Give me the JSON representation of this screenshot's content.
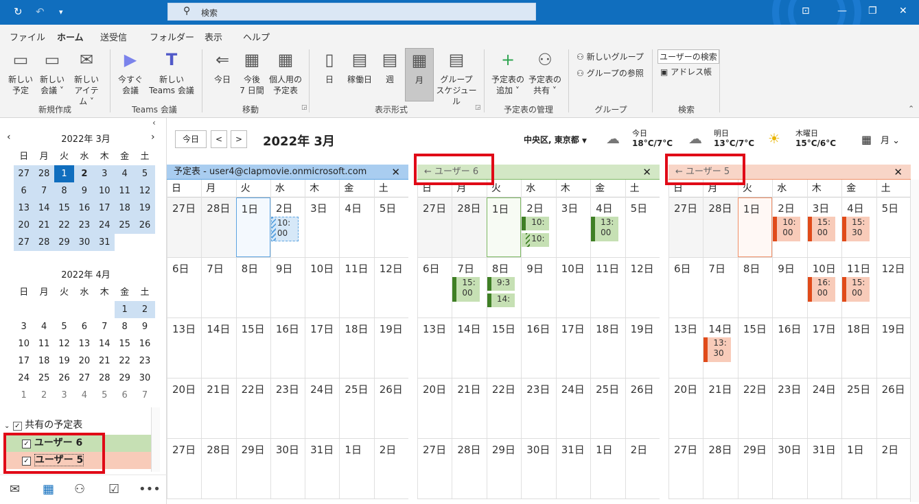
{
  "app": {
    "search_placeholder": "検索",
    "colors": {
      "accent": "#106ebe",
      "user6": "#c6e0b4",
      "user6_bar": "#3f7f25",
      "user5": "#f8cbb9",
      "user5_bar": "#e04b1a",
      "default": "#a9cdf0"
    }
  },
  "quick_access": {
    "sync_icon": "↻",
    "undo_icon": "↶",
    "custom_icon": "▾"
  },
  "menu": {
    "tabs": [
      "ファイル",
      "ホーム",
      "送受信",
      "フォルダー",
      "表示",
      "ヘルプ"
    ]
  },
  "ribbon": {
    "buttons": [
      {
        "label": "新しい\n予定",
        "icon": "calendar-new-icon",
        "g": "▭"
      },
      {
        "label": "新しい\n会議 ˅",
        "icon": "meeting-icon",
        "g": "▭"
      },
      {
        "label": "新しい\nアイテム ˅",
        "icon": "new-item-icon",
        "g": "✉"
      },
      {
        "label": "今すぐ\n会議",
        "icon": "video-icon",
        "g": "▶"
      },
      {
        "label": "新しい\nTeams 会議",
        "icon": "teams-icon",
        "g": "T"
      },
      {
        "label": "今日",
        "icon": "today-icon",
        "g": "⇐"
      },
      {
        "label": "今後\n7 日間",
        "icon": "next7-icon",
        "g": "▦"
      },
      {
        "label": "個人用の\n予定表",
        "icon": "personal-cal-icon",
        "g": "▦"
      },
      {
        "label": "日",
        "icon": "day-view-icon",
        "g": "▯"
      },
      {
        "label": "稼働日",
        "icon": "workweek-icon",
        "g": "▤"
      },
      {
        "label": "週",
        "icon": "week-view-icon",
        "g": "▤"
      },
      {
        "label": "月",
        "icon": "month-view-icon",
        "g": "▦"
      },
      {
        "label": "グループ\nスケジュール",
        "icon": "group-schedule-icon",
        "g": "▤"
      },
      {
        "label": "予定表の\n追加 ˅",
        "icon": "add-calendar-icon",
        "g": "+"
      },
      {
        "label": "予定表の\n共有 ˅",
        "icon": "share-calendar-icon",
        "g": "⚇"
      }
    ],
    "groups": [
      "新規作成",
      "Teams 会議",
      "移動",
      "表示形式",
      "予定表の管理",
      "グループ",
      "検索"
    ],
    "small": {
      "new_group": "新しいグループ",
      "browse_group": "グループの参照",
      "user_search": "ユーザーの検索",
      "address_book": "アドレス帳"
    }
  },
  "minical": [
    {
      "title": "2022年 3月",
      "days": [
        "日",
        "月",
        "火",
        "水",
        "木",
        "金",
        "土"
      ],
      "cells": [
        "27",
        "28",
        "1",
        "2",
        "3",
        "4",
        "5",
        "6",
        "7",
        "8",
        "9",
        "10",
        "11",
        "12",
        "13",
        "14",
        "15",
        "16",
        "17",
        "18",
        "19",
        "20",
        "21",
        "22",
        "23",
        "24",
        "25",
        "26",
        "27",
        "28",
        "29",
        "30",
        "31"
      ]
    },
    {
      "title": "2022年 4月",
      "days": [
        "日",
        "月",
        "火",
        "水",
        "木",
        "金",
        "土"
      ],
      "cells": [
        "",
        "",
        "",
        "",
        "",
        "1",
        "2",
        "3",
        "4",
        "5",
        "6",
        "7",
        "8",
        "9",
        "10",
        "11",
        "12",
        "13",
        "14",
        "15",
        "16",
        "17",
        "18",
        "19",
        "20",
        "21",
        "22",
        "23",
        "24",
        "25",
        "26",
        "27",
        "28",
        "29",
        "30",
        "1",
        "2",
        "3",
        "4",
        "5",
        "6",
        "7"
      ]
    }
  ],
  "shared": {
    "label": "共有の予定表",
    "users": [
      "ユーザー 6",
      "ユーザー 5"
    ]
  },
  "toolbar": {
    "today": "今日",
    "prev": "<",
    "next": ">",
    "month_title": "2022年 3月",
    "location": "中央区, 東京都",
    "view": "月"
  },
  "weather": [
    {
      "day": "今日",
      "temp": "18°C/7°C"
    },
    {
      "day": "明日",
      "temp": "13°C/7°C"
    },
    {
      "day": "木曜日",
      "temp": "15°C/6°C"
    }
  ],
  "calendars": [
    {
      "title": "予定表 - user4@clapmovie.onmicrosoft.com",
      "color": "#a9cdf0",
      "line": "#5ba3e0"
    },
    {
      "title": "← ユーザー 6",
      "color": "#d3e7c5",
      "line": "#7cb862"
    },
    {
      "title": "← ユーザー 5",
      "color": "#f8d5c7",
      "line": "#f08f67"
    }
  ],
  "weekdays": [
    "日",
    "月",
    "火",
    "水",
    "木",
    "金",
    "土"
  ],
  "weeks": [
    [
      "27日",
      "28日",
      "1日",
      "2日",
      "3日",
      "4日",
      "5日"
    ],
    [
      "6日",
      "7日",
      "8日",
      "9日",
      "10日",
      "11日",
      "12日"
    ],
    [
      "13日",
      "14日",
      "15日",
      "16日",
      "17日",
      "18日",
      "19日"
    ],
    [
      "20日",
      "21日",
      "22日",
      "23日",
      "24日",
      "25日",
      "26日"
    ],
    [
      "27日",
      "28日",
      "29日",
      "30日",
      "31日",
      "1日",
      "2日"
    ]
  ],
  "events": [
    [
      {
        "w": 0,
        "d": 3,
        "t": "10:\n00",
        "s": "tent"
      }
    ],
    [
      {
        "w": 0,
        "d": 3,
        "t": "10:",
        "s": "busy"
      },
      {
        "w": 0,
        "d": 3,
        "t": "10:",
        "s": "tent",
        "i": 1
      },
      {
        "w": 0,
        "d": 5,
        "t": "13:\n00",
        "s": "busy"
      },
      {
        "w": 1,
        "d": 1,
        "t": "15:\n00",
        "s": "busy"
      },
      {
        "w": 1,
        "d": 2,
        "t": "9:3",
        "s": "busy"
      },
      {
        "w": 1,
        "d": 2,
        "t": "14:",
        "s": "busy",
        "i": 1
      }
    ],
    [
      {
        "w": 0,
        "d": 3,
        "t": "10:\n00",
        "s": "busy"
      },
      {
        "w": 0,
        "d": 4,
        "t": "15:\n00",
        "s": "busy"
      },
      {
        "w": 0,
        "d": 5,
        "t": "15:\n30",
        "s": "busy"
      },
      {
        "w": 1,
        "d": 4,
        "t": "16:\n00",
        "s": "busy"
      },
      {
        "w": 1,
        "d": 5,
        "t": "15:\n00",
        "s": "busy"
      },
      {
        "w": 2,
        "d": 1,
        "t": "13:\n30",
        "s": "busy"
      }
    ]
  ]
}
